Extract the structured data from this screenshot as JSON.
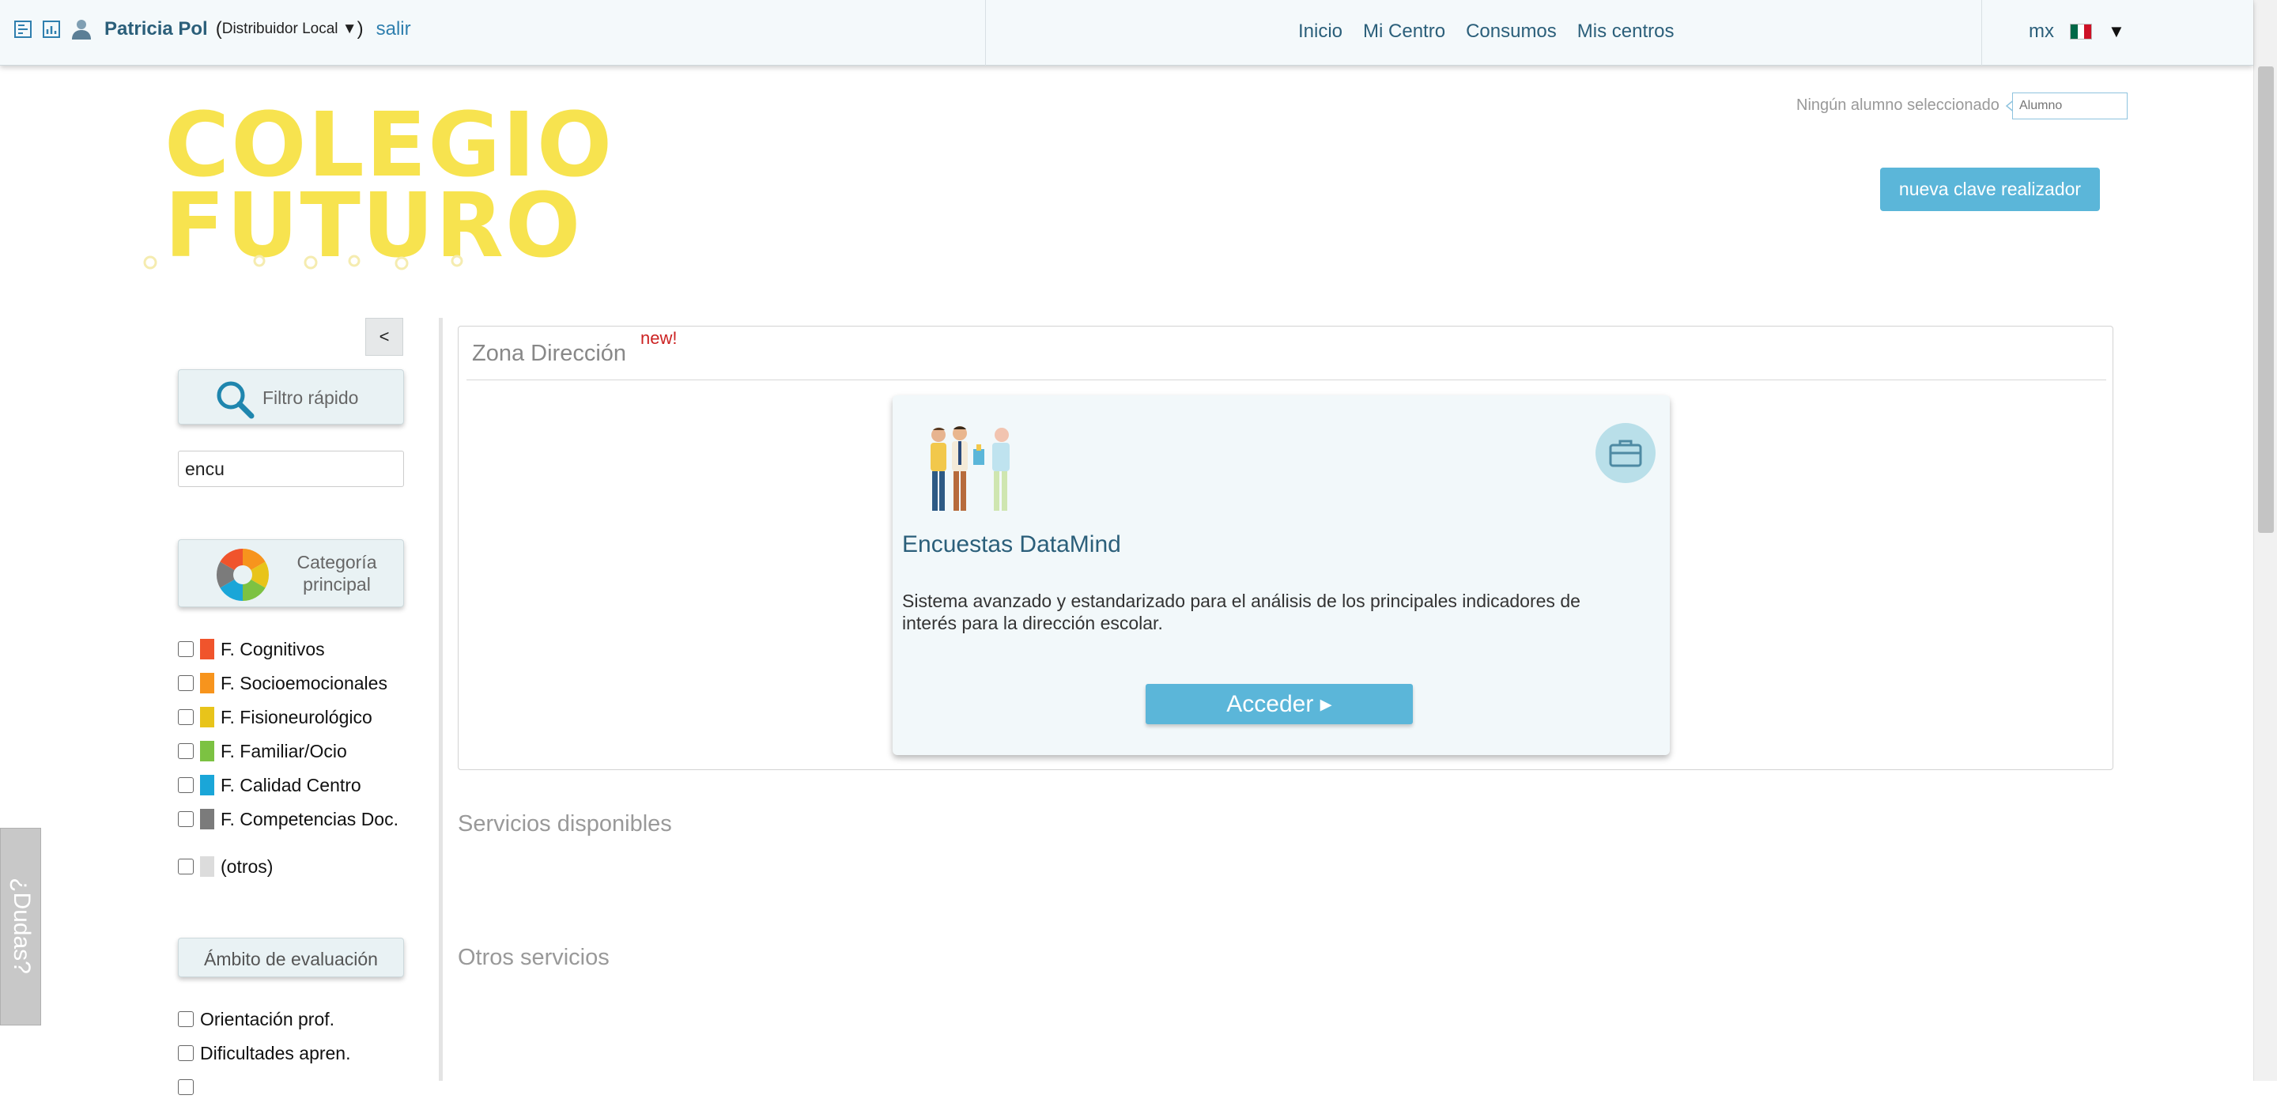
{
  "topbar": {
    "user_name": "Patricia Pol",
    "paren_open": "(",
    "role": "Distribuidor Local ▼",
    "paren_close": ")",
    "logout": "salir",
    "nav": [
      "Inicio",
      "Mi Centro",
      "Consumos",
      "Mis centros"
    ],
    "lang_code": "mx",
    "lang_caret": "▼",
    "flag_colors": [
      "#006847",
      "#ffffff",
      "#ce1126"
    ]
  },
  "header": {
    "logo_line1": "COLEGIO",
    "logo_line2": "FUTURO",
    "student_status": "Ningún alumno seleccionado",
    "student_placeholder": "Alumno",
    "new_key_button": "nueva clave realizador"
  },
  "sidebar": {
    "collapse_label": "<",
    "quick_filter_label": "Filtro rápido",
    "filter_value": "encu",
    "category_label": "Categoría principal",
    "categories": [
      {
        "label": "F. Cognitivos",
        "color": "#f0542c"
      },
      {
        "label": "F. Socioemocionales",
        "color": "#f7941d"
      },
      {
        "label": "F. Fisioneurológico",
        "color": "#e8c41a"
      },
      {
        "label": "F. Familiar/Ocio",
        "color": "#7cc242"
      },
      {
        "label": "F. Calidad Centro",
        "color": "#1aa6d8"
      },
      {
        "label": "F. Competencias Doc.",
        "color": "#7b7b7b"
      },
      {
        "label": "(otros)",
        "color": "#dcdcdc"
      }
    ],
    "scope_label": "Ámbito de evaluación",
    "scopes": [
      "Orientación prof.",
      "Dificultades apren."
    ],
    "help_tab": "¿Dudas?"
  },
  "main": {
    "zone_title": "Zona Dirección",
    "zone_badge": "new!",
    "card": {
      "title": "Encuestas DataMind",
      "description": "Sistema avanzado y estandarizado para el análisis de los principales indicadores de interés para la dirección escolar.",
      "button": "Acceder ▸"
    },
    "available_services": "Servicios disponibles",
    "other_services": "Otros servicios"
  }
}
